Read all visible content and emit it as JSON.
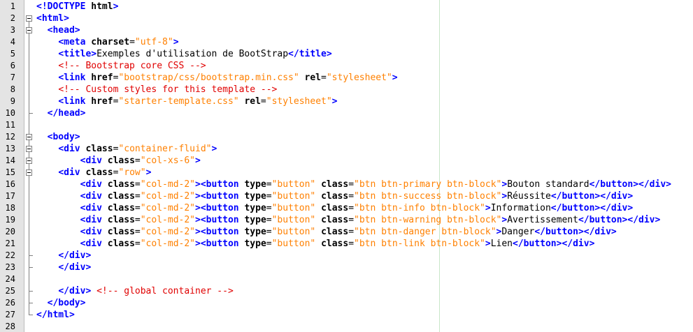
{
  "editor": {
    "accent": "#0000ff",
    "string_color": "#ff8000",
    "comment_color": "#e00000",
    "lines": [
      {
        "n": "1",
        "indent": "",
        "fold": "none",
        "tokens": [
          [
            "tag",
            "<!"
          ],
          [
            "doctype",
            "DOCTYPE"
          ],
          [
            "doc",
            " "
          ],
          [
            "attr",
            "html"
          ],
          [
            "tag",
            ">"
          ]
        ]
      },
      {
        "n": "2",
        "indent": "",
        "fold": "open",
        "tokens": [
          [
            "tag",
            "<html>"
          ]
        ]
      },
      {
        "n": "3",
        "indent": "  ",
        "fold": "open",
        "tokens": [
          [
            "tag",
            "<head>"
          ]
        ]
      },
      {
        "n": "4",
        "indent": "    ",
        "fold": "line",
        "tokens": [
          [
            "tag",
            "<meta "
          ],
          [
            "attr",
            "charset"
          ],
          [
            "doc",
            "="
          ],
          [
            "str",
            "\"utf-8\""
          ],
          [
            "tag",
            ">"
          ]
        ]
      },
      {
        "n": "5",
        "indent": "    ",
        "fold": "line",
        "tokens": [
          [
            "tag",
            "<title>"
          ],
          [
            "doc",
            "Exemples d'utilisation de BootStrap"
          ],
          [
            "tag",
            "</title>"
          ]
        ]
      },
      {
        "n": "6",
        "indent": "    ",
        "fold": "line",
        "tokens": [
          [
            "cmt",
            "<!-- Bootstrap core CSS -->"
          ]
        ]
      },
      {
        "n": "7",
        "indent": "    ",
        "fold": "line",
        "tokens": [
          [
            "tag",
            "<link "
          ],
          [
            "attr",
            "href"
          ],
          [
            "doc",
            "="
          ],
          [
            "str",
            "\"bootstrap/css/bootstrap.min.css\""
          ],
          [
            "doc",
            " "
          ],
          [
            "attr",
            "rel"
          ],
          [
            "doc",
            "="
          ],
          [
            "str",
            "\"stylesheet\""
          ],
          [
            "tag",
            ">"
          ]
        ]
      },
      {
        "n": "8",
        "indent": "    ",
        "fold": "line",
        "tokens": [
          [
            "cmt",
            "<!-- Custom styles for this template -->"
          ]
        ]
      },
      {
        "n": "9",
        "indent": "    ",
        "fold": "line",
        "tokens": [
          [
            "tag",
            "<link "
          ],
          [
            "attr",
            "href"
          ],
          [
            "doc",
            "="
          ],
          [
            "str",
            "\"starter-template.css\""
          ],
          [
            "doc",
            " "
          ],
          [
            "attr",
            "rel"
          ],
          [
            "doc",
            "="
          ],
          [
            "str",
            "\"stylesheet\""
          ],
          [
            "tag",
            ">"
          ]
        ]
      },
      {
        "n": "10",
        "indent": "  ",
        "fold": "end",
        "tokens": [
          [
            "tag",
            "</head>"
          ]
        ]
      },
      {
        "n": "11",
        "indent": "",
        "fold": "line",
        "tokens": []
      },
      {
        "n": "12",
        "indent": "  ",
        "fold": "open",
        "tokens": [
          [
            "tag",
            "<body>"
          ]
        ]
      },
      {
        "n": "13",
        "indent": "    ",
        "fold": "open",
        "tokens": [
          [
            "tag",
            "<div "
          ],
          [
            "attr",
            "class"
          ],
          [
            "doc",
            "="
          ],
          [
            "str",
            "\"container-fluid\""
          ],
          [
            "tag",
            ">"
          ]
        ]
      },
      {
        "n": "14",
        "indent": "        ",
        "fold": "open",
        "tokens": [
          [
            "tag",
            "<div "
          ],
          [
            "attr",
            "class"
          ],
          [
            "doc",
            "="
          ],
          [
            "str",
            "\"col-xs-6\""
          ],
          [
            "tag",
            ">"
          ]
        ]
      },
      {
        "n": "15",
        "indent": "    ",
        "fold": "open",
        "tokens": [
          [
            "tag",
            "<div "
          ],
          [
            "attr",
            "class"
          ],
          [
            "doc",
            "="
          ],
          [
            "str",
            "\"row\""
          ],
          [
            "tag",
            ">"
          ]
        ]
      },
      {
        "n": "16",
        "indent": "        ",
        "fold": "line",
        "tokens": [
          [
            "tag",
            "<div "
          ],
          [
            "attr",
            "class"
          ],
          [
            "doc",
            "="
          ],
          [
            "str",
            "\"col-md-2\""
          ],
          [
            "tag",
            "><button "
          ],
          [
            "attr",
            "type"
          ],
          [
            "doc",
            "="
          ],
          [
            "str",
            "\"button\""
          ],
          [
            "doc",
            " "
          ],
          [
            "attr",
            "class"
          ],
          [
            "doc",
            "="
          ],
          [
            "str",
            "\"btn btn-primary btn-block\""
          ],
          [
            "tag",
            ">"
          ],
          [
            "doc",
            "Bouton standard"
          ],
          [
            "tag",
            "</button></div>"
          ]
        ]
      },
      {
        "n": "17",
        "indent": "        ",
        "fold": "line",
        "tokens": [
          [
            "tag",
            "<div "
          ],
          [
            "attr",
            "class"
          ],
          [
            "doc",
            "="
          ],
          [
            "str",
            "\"col-md-2\""
          ],
          [
            "tag",
            "><button "
          ],
          [
            "attr",
            "type"
          ],
          [
            "doc",
            "="
          ],
          [
            "str",
            "\"button\""
          ],
          [
            "doc",
            " "
          ],
          [
            "attr",
            "class"
          ],
          [
            "doc",
            "="
          ],
          [
            "str",
            "\"btn btn-success btn-block\""
          ],
          [
            "tag",
            ">"
          ],
          [
            "doc",
            "Réussite"
          ],
          [
            "tag",
            "</button></div>"
          ]
        ]
      },
      {
        "n": "18",
        "indent": "        ",
        "fold": "line",
        "tokens": [
          [
            "tag",
            "<div "
          ],
          [
            "attr",
            "class"
          ],
          [
            "doc",
            "="
          ],
          [
            "str",
            "\"col-md-2\""
          ],
          [
            "tag",
            "><button "
          ],
          [
            "attr",
            "type"
          ],
          [
            "doc",
            "="
          ],
          [
            "str",
            "\"button\""
          ],
          [
            "doc",
            " "
          ],
          [
            "attr",
            "class"
          ],
          [
            "doc",
            "="
          ],
          [
            "str",
            "\"btn btn-info btn-block\""
          ],
          [
            "tag",
            ">"
          ],
          [
            "doc",
            "Information"
          ],
          [
            "tag",
            "</button></div>"
          ]
        ]
      },
      {
        "n": "19",
        "indent": "        ",
        "fold": "line",
        "tokens": [
          [
            "tag",
            "<div "
          ],
          [
            "attr",
            "class"
          ],
          [
            "doc",
            "="
          ],
          [
            "str",
            "\"col-md-2\""
          ],
          [
            "tag",
            "><button "
          ],
          [
            "attr",
            "type"
          ],
          [
            "doc",
            "="
          ],
          [
            "str",
            "\"button\""
          ],
          [
            "doc",
            " "
          ],
          [
            "attr",
            "class"
          ],
          [
            "doc",
            "="
          ],
          [
            "str",
            "\"btn btn-warning btn-block\""
          ],
          [
            "tag",
            ">"
          ],
          [
            "doc",
            "Avertissement"
          ],
          [
            "tag",
            "</button></div>"
          ]
        ]
      },
      {
        "n": "20",
        "indent": "        ",
        "fold": "line",
        "tokens": [
          [
            "tag",
            "<div "
          ],
          [
            "attr",
            "class"
          ],
          [
            "doc",
            "="
          ],
          [
            "str",
            "\"col-md-2\""
          ],
          [
            "tag",
            "><button "
          ],
          [
            "attr",
            "type"
          ],
          [
            "doc",
            "="
          ],
          [
            "str",
            "\"button\""
          ],
          [
            "doc",
            " "
          ],
          [
            "attr",
            "class"
          ],
          [
            "doc",
            "="
          ],
          [
            "str",
            "\"btn btn-danger btn-block\""
          ],
          [
            "tag",
            ">"
          ],
          [
            "doc",
            "Danger"
          ],
          [
            "tag",
            "</button></div>"
          ]
        ]
      },
      {
        "n": "21",
        "indent": "        ",
        "fold": "line",
        "tokens": [
          [
            "tag",
            "<div "
          ],
          [
            "attr",
            "class"
          ],
          [
            "doc",
            "="
          ],
          [
            "str",
            "\"col-md-2\""
          ],
          [
            "tag",
            "><button "
          ],
          [
            "attr",
            "type"
          ],
          [
            "doc",
            "="
          ],
          [
            "str",
            "\"button\""
          ],
          [
            "doc",
            " "
          ],
          [
            "attr",
            "class"
          ],
          [
            "doc",
            "="
          ],
          [
            "str",
            "\"btn btn-link btn-block\""
          ],
          [
            "tag",
            ">"
          ],
          [
            "doc",
            "Lien"
          ],
          [
            "tag",
            "</button></div>"
          ]
        ]
      },
      {
        "n": "22",
        "indent": "    ",
        "fold": "end",
        "tokens": [
          [
            "tag",
            "</div>"
          ]
        ]
      },
      {
        "n": "23",
        "indent": "    ",
        "fold": "end",
        "tokens": [
          [
            "tag",
            "</div>"
          ]
        ]
      },
      {
        "n": "24",
        "indent": "",
        "fold": "line",
        "tokens": []
      },
      {
        "n": "25",
        "indent": "    ",
        "fold": "end",
        "tokens": [
          [
            "tag",
            "</div>"
          ],
          [
            "doc",
            " "
          ],
          [
            "cmt",
            "<!-- global container -->"
          ]
        ]
      },
      {
        "n": "26",
        "indent": "  ",
        "fold": "end",
        "tokens": [
          [
            "tag",
            "</body>"
          ]
        ]
      },
      {
        "n": "27",
        "indent": "",
        "fold": "end",
        "tokens": [
          [
            "tag",
            "</html>"
          ]
        ]
      },
      {
        "n": "28",
        "indent": "",
        "fold": "none",
        "tokens": []
      }
    ]
  }
}
